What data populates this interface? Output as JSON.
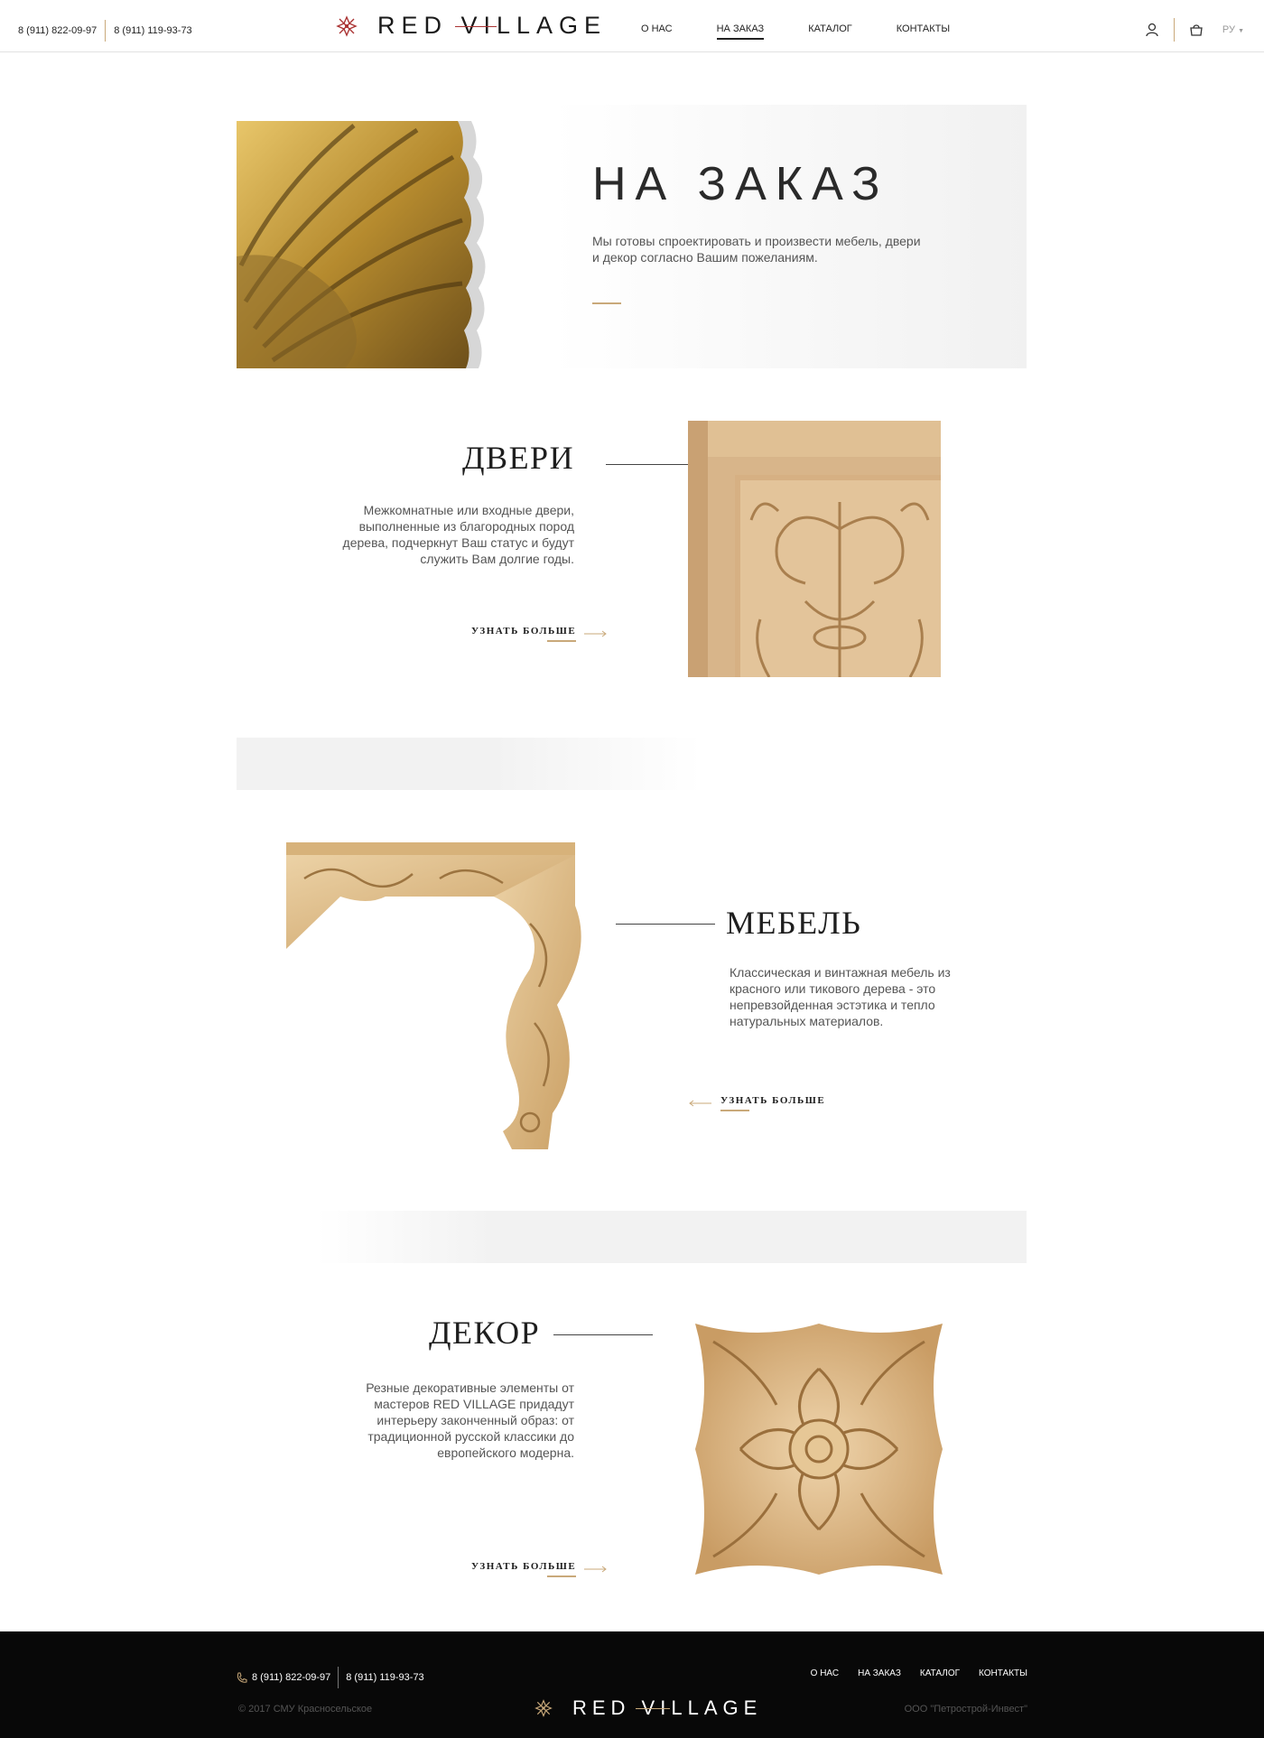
{
  "header": {
    "phone1": "8 (911) 822-09-97",
    "phone2": "8 (911) 119-93-73",
    "logo_text": "RED VILLAGE",
    "nav": [
      {
        "label": "О НАС",
        "active": false
      },
      {
        "label": "НА ЗАКАЗ",
        "active": true
      },
      {
        "label": "КАТАЛОГ",
        "active": false
      },
      {
        "label": "КОНТАКТЫ",
        "active": false
      }
    ],
    "lang": "РУ"
  },
  "hero": {
    "title": "НА ЗАКАЗ",
    "text": "Мы готовы спроектировать и произвести мебель, двери и декор согласно Вашим пожеланиям."
  },
  "sections": {
    "doors": {
      "title": "ДВЕРИ",
      "text": "Межкомнатные или входные двери, выполненные из благородных пород дерева, подчеркнут Ваш статус и будут служить Вам долгие годы.",
      "more": "УЗНАТЬ БОЛЬШЕ"
    },
    "furniture": {
      "title": "МЕБЕЛЬ",
      "text": "Классическая и винтажная мебель из красного или тикового дерева - это непревзойденная эстэтика и тепло натуральных материалов.",
      "more": "УЗНАТЬ БОЛЬШЕ"
    },
    "decor": {
      "title": "ДЕКОР",
      "text": "Резные декоративные элементы от мастеров RED VILLAGE придадут интерьеру законченный образ: от традиционной русской классики до европейского модерна.",
      "more": "УЗНАТЬ БОЛЬШЕ"
    }
  },
  "footer": {
    "phone1": "8 (911) 822-09-97",
    "phone2": "8 (911) 119-93-73",
    "nav": [
      "О НАС",
      "НА ЗАКАЗ",
      "КАТАЛОГ",
      "КОНТАКТЫ"
    ],
    "copyright": "© 2017 СМУ Красносельское",
    "logo_text": "RED VILLAGE",
    "company": "ООО \"Петрострой-Инвест\""
  },
  "icons": {
    "logo_mark": "ornament-mark-icon",
    "user": "user-icon",
    "cart": "cart-icon",
    "phone": "phone-icon"
  },
  "colors": {
    "accent_gold": "#c9a97a",
    "logo_red": "#a33333",
    "footer_bg": "#080808"
  }
}
